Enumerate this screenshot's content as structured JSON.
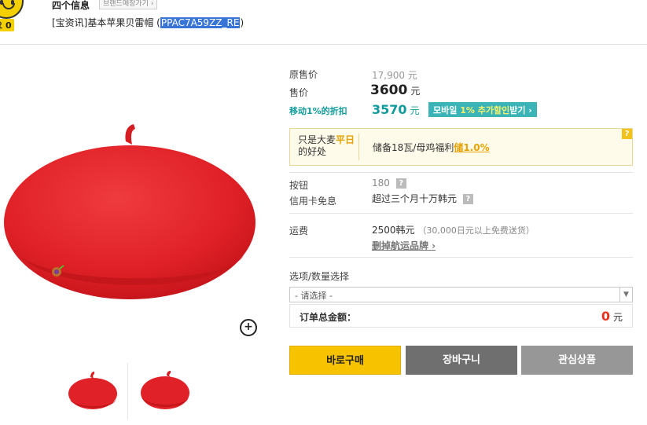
{
  "header": {
    "badge_count": "0",
    "badge_prefix": "요",
    "shop_name": "四个信息",
    "shop_button": "브랜드매장가기 ›",
    "title_prefix": "[宝资讯]基本苹果贝雷帽 (",
    "title_code": "PPAC7A59ZZ_RE",
    "title_suffix": ")"
  },
  "price": {
    "original_label": "原售价",
    "original_value": "17,900 元",
    "sale_label": "售价",
    "sale_value": "3600",
    "currency": "元",
    "mobile_label": "移动1%的折扣",
    "mobile_value": "3570",
    "mobile_button_prefix": "모바일 ",
    "mobile_button_highlight": "1% 추가할인",
    "mobile_button_suffix": "받기 ›"
  },
  "benefit": {
    "label_line1_a": "只是大麦",
    "label_line1_b": "平日",
    "label_line2": "的好处",
    "text": "储备18瓦/母鸡福利",
    "percent": "储1.0%",
    "help": "?"
  },
  "details": {
    "points_label": "按钮",
    "points_value": "180",
    "card_label": "信用卡免息",
    "card_value": "超过三个月十万韩元",
    "shipping_label": "运费",
    "shipping_value": "2500韩元",
    "shipping_note": "（30,000日元以上免费送货）",
    "shipping_link": "删掉航运品牌 ›",
    "help": "?"
  },
  "options": {
    "label": "选项/数量选择",
    "placeholder": "- 请选择 -",
    "total_label": "订单总金额：",
    "total_value": "0",
    "currency": "元"
  },
  "buttons": {
    "buy": "바로구매",
    "cart": "장바구니",
    "wish": "관심상품"
  },
  "icons": {
    "zoom": "zoom-plus-icon",
    "arrow": "▼",
    "zoom_glyph": "+"
  },
  "colors": {
    "accent_yellow": "#f7c200",
    "mobile_teal": "#0f9b9b",
    "total_red": "#e8331c",
    "beret_red": "#e8232a"
  }
}
